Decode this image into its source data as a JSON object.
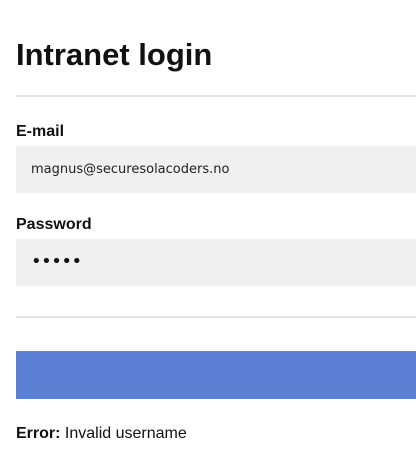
{
  "page": {
    "title": "Intranet login"
  },
  "form": {
    "email": {
      "label": "E-mail",
      "value": "magnus@securesolacoders.no"
    },
    "password": {
      "label": "Password",
      "masked_value": "•••••"
    },
    "submit": {
      "label": "",
      "color": "#5b80d6"
    }
  },
  "error": {
    "prefix": "Error:",
    "message": "Invalid username"
  }
}
